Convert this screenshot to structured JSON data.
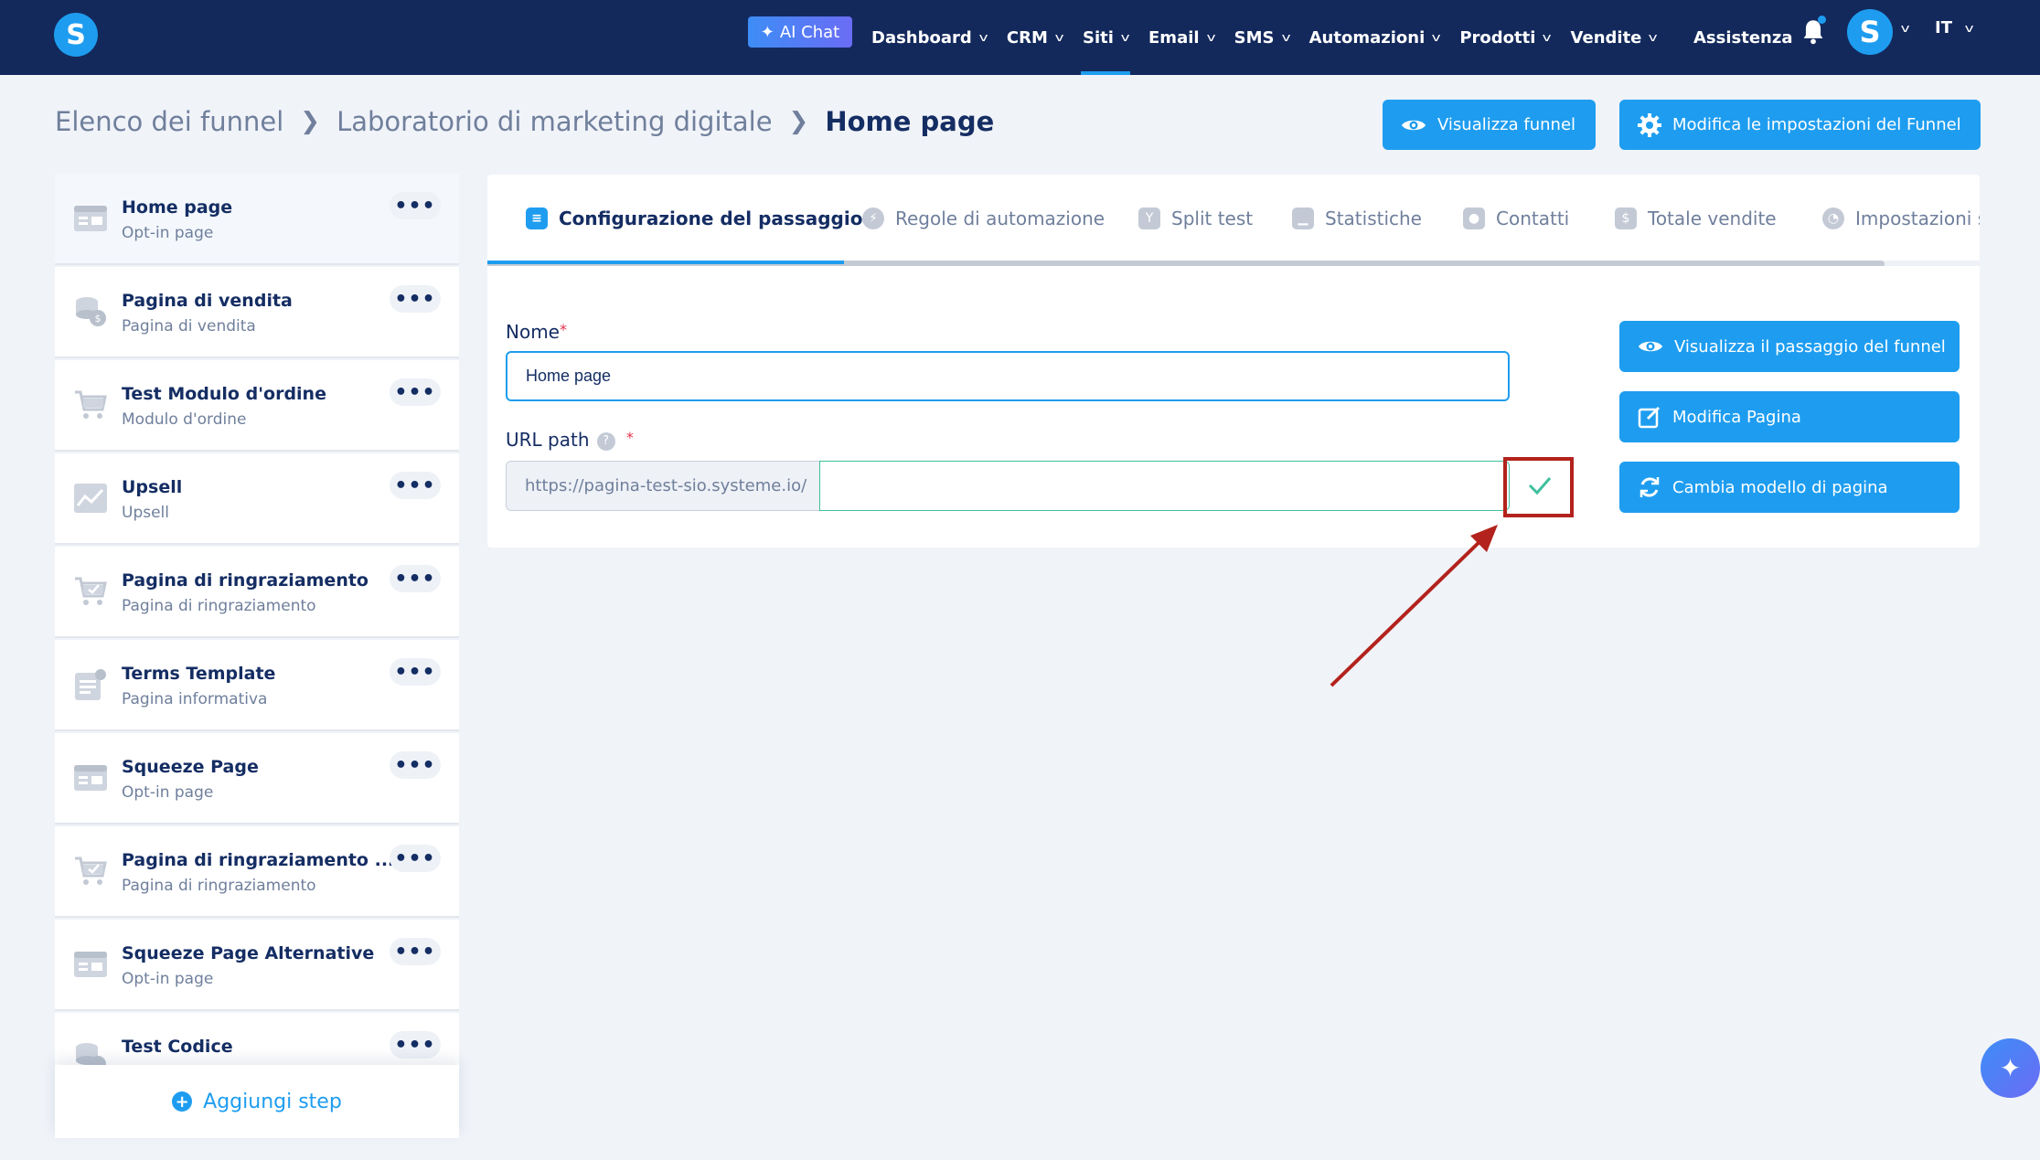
{
  "topnav": {
    "logo_letter": "S",
    "ai_chat_label": "AI Chat",
    "items": [
      {
        "label": "Dashboard",
        "active": false
      },
      {
        "label": "CRM",
        "active": false
      },
      {
        "label": "Siti",
        "active": true
      },
      {
        "label": "Email",
        "active": false
      },
      {
        "label": "SMS",
        "active": false
      },
      {
        "label": "Automazioni",
        "active": false
      },
      {
        "label": "Prodotti",
        "active": false
      },
      {
        "label": "Vendite",
        "active": false
      }
    ],
    "assist_label": "Assistenza",
    "avatar_letter": "S",
    "language": "IT"
  },
  "breadcrumb": {
    "item1": "Elenco dei funnel",
    "item2": "Laboratorio di marketing digitale",
    "current": "Home page"
  },
  "header_buttons": {
    "view_funnel": "Visualizza funnel",
    "edit_settings": "Modifica le impostazioni del Funnel"
  },
  "steps": [
    {
      "title": "Home page",
      "subtitle": "Opt-in page",
      "icon": "optin-page-icon"
    },
    {
      "title": "Pagina di vendita",
      "subtitle": "Pagina di vendita",
      "icon": "sales-page-icon"
    },
    {
      "title": "Test Modulo d'ordine",
      "subtitle": "Modulo d'ordine",
      "icon": "cart-icon"
    },
    {
      "title": "Upsell",
      "subtitle": "Upsell",
      "icon": "upsell-chart-icon"
    },
    {
      "title": "Pagina di ringraziamento",
      "subtitle": "Pagina di ringraziamento",
      "icon": "cart-check-icon"
    },
    {
      "title": "Terms Template",
      "subtitle": "Pagina informativa",
      "icon": "info-page-icon"
    },
    {
      "title": "Squeeze Page",
      "subtitle": "Opt-in page",
      "icon": "optin-page-icon"
    },
    {
      "title": "Pagina di ringraziamento ...",
      "subtitle": "Pagina di ringraziamento",
      "icon": "cart-check-icon"
    },
    {
      "title": "Squeeze Page Alternative",
      "subtitle": "Opt-in page",
      "icon": "optin-page-icon"
    },
    {
      "title": "Test Codice",
      "subtitle": "",
      "icon": "sales-page-icon"
    }
  ],
  "more_label": "•••",
  "add_step_label": "Aggiungi step",
  "tabs": [
    {
      "label": "Configurazione del passaggio",
      "active": true
    },
    {
      "label": "Regole di automazione",
      "active": false
    },
    {
      "label": "Split test",
      "active": false
    },
    {
      "label": "Statistiche",
      "active": false
    },
    {
      "label": "Contatti",
      "active": false
    },
    {
      "label": "Totale vendite",
      "active": false
    },
    {
      "label": "Impostazioni s",
      "active": false
    }
  ],
  "form": {
    "name_label": "Nome",
    "name_value": "Home page",
    "url_label": "URL path",
    "url_prefix": "https://pagina-test-sio.systeme.io/",
    "url_value": "",
    "required_mark": "*",
    "help_mark": "?"
  },
  "side_buttons": {
    "view_step": "Visualizza il passaggio del funnel",
    "edit_page": "Modifica Pagina",
    "change_template": "Cambia modello di pagina"
  },
  "colors": {
    "nav_bg": "#13295c",
    "accent": "#1e9df0",
    "success": "#3fc09d",
    "highlight": "#b3221c"
  }
}
